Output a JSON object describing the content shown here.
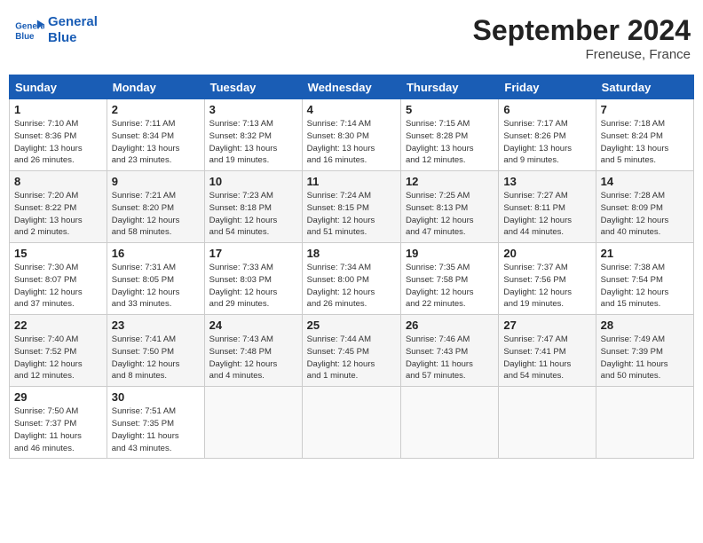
{
  "header": {
    "logo_line1": "General",
    "logo_line2": "Blue",
    "month_title": "September 2024",
    "location": "Freneuse, France"
  },
  "weekdays": [
    "Sunday",
    "Monday",
    "Tuesday",
    "Wednesday",
    "Thursday",
    "Friday",
    "Saturday"
  ],
  "weeks": [
    [
      {
        "day": "1",
        "info": "Sunrise: 7:10 AM\nSunset: 8:36 PM\nDaylight: 13 hours\nand 26 minutes."
      },
      {
        "day": "2",
        "info": "Sunrise: 7:11 AM\nSunset: 8:34 PM\nDaylight: 13 hours\nand 23 minutes."
      },
      {
        "day": "3",
        "info": "Sunrise: 7:13 AM\nSunset: 8:32 PM\nDaylight: 13 hours\nand 19 minutes."
      },
      {
        "day": "4",
        "info": "Sunrise: 7:14 AM\nSunset: 8:30 PM\nDaylight: 13 hours\nand 16 minutes."
      },
      {
        "day": "5",
        "info": "Sunrise: 7:15 AM\nSunset: 8:28 PM\nDaylight: 13 hours\nand 12 minutes."
      },
      {
        "day": "6",
        "info": "Sunrise: 7:17 AM\nSunset: 8:26 PM\nDaylight: 13 hours\nand 9 minutes."
      },
      {
        "day": "7",
        "info": "Sunrise: 7:18 AM\nSunset: 8:24 PM\nDaylight: 13 hours\nand 5 minutes."
      }
    ],
    [
      {
        "day": "8",
        "info": "Sunrise: 7:20 AM\nSunset: 8:22 PM\nDaylight: 13 hours\nand 2 minutes."
      },
      {
        "day": "9",
        "info": "Sunrise: 7:21 AM\nSunset: 8:20 PM\nDaylight: 12 hours\nand 58 minutes."
      },
      {
        "day": "10",
        "info": "Sunrise: 7:23 AM\nSunset: 8:18 PM\nDaylight: 12 hours\nand 54 minutes."
      },
      {
        "day": "11",
        "info": "Sunrise: 7:24 AM\nSunset: 8:15 PM\nDaylight: 12 hours\nand 51 minutes."
      },
      {
        "day": "12",
        "info": "Sunrise: 7:25 AM\nSunset: 8:13 PM\nDaylight: 12 hours\nand 47 minutes."
      },
      {
        "day": "13",
        "info": "Sunrise: 7:27 AM\nSunset: 8:11 PM\nDaylight: 12 hours\nand 44 minutes."
      },
      {
        "day": "14",
        "info": "Sunrise: 7:28 AM\nSunset: 8:09 PM\nDaylight: 12 hours\nand 40 minutes."
      }
    ],
    [
      {
        "day": "15",
        "info": "Sunrise: 7:30 AM\nSunset: 8:07 PM\nDaylight: 12 hours\nand 37 minutes."
      },
      {
        "day": "16",
        "info": "Sunrise: 7:31 AM\nSunset: 8:05 PM\nDaylight: 12 hours\nand 33 minutes."
      },
      {
        "day": "17",
        "info": "Sunrise: 7:33 AM\nSunset: 8:03 PM\nDaylight: 12 hours\nand 29 minutes."
      },
      {
        "day": "18",
        "info": "Sunrise: 7:34 AM\nSunset: 8:00 PM\nDaylight: 12 hours\nand 26 minutes."
      },
      {
        "day": "19",
        "info": "Sunrise: 7:35 AM\nSunset: 7:58 PM\nDaylight: 12 hours\nand 22 minutes."
      },
      {
        "day": "20",
        "info": "Sunrise: 7:37 AM\nSunset: 7:56 PM\nDaylight: 12 hours\nand 19 minutes."
      },
      {
        "day": "21",
        "info": "Sunrise: 7:38 AM\nSunset: 7:54 PM\nDaylight: 12 hours\nand 15 minutes."
      }
    ],
    [
      {
        "day": "22",
        "info": "Sunrise: 7:40 AM\nSunset: 7:52 PM\nDaylight: 12 hours\nand 12 minutes."
      },
      {
        "day": "23",
        "info": "Sunrise: 7:41 AM\nSunset: 7:50 PM\nDaylight: 12 hours\nand 8 minutes."
      },
      {
        "day": "24",
        "info": "Sunrise: 7:43 AM\nSunset: 7:48 PM\nDaylight: 12 hours\nand 4 minutes."
      },
      {
        "day": "25",
        "info": "Sunrise: 7:44 AM\nSunset: 7:45 PM\nDaylight: 12 hours\nand 1 minute."
      },
      {
        "day": "26",
        "info": "Sunrise: 7:46 AM\nSunset: 7:43 PM\nDaylight: 11 hours\nand 57 minutes."
      },
      {
        "day": "27",
        "info": "Sunrise: 7:47 AM\nSunset: 7:41 PM\nDaylight: 11 hours\nand 54 minutes."
      },
      {
        "day": "28",
        "info": "Sunrise: 7:49 AM\nSunset: 7:39 PM\nDaylight: 11 hours\nand 50 minutes."
      }
    ],
    [
      {
        "day": "29",
        "info": "Sunrise: 7:50 AM\nSunset: 7:37 PM\nDaylight: 11 hours\nand 46 minutes."
      },
      {
        "day": "30",
        "info": "Sunrise: 7:51 AM\nSunset: 7:35 PM\nDaylight: 11 hours\nand 43 minutes."
      },
      {
        "day": "",
        "info": ""
      },
      {
        "day": "",
        "info": ""
      },
      {
        "day": "",
        "info": ""
      },
      {
        "day": "",
        "info": ""
      },
      {
        "day": "",
        "info": ""
      }
    ]
  ]
}
